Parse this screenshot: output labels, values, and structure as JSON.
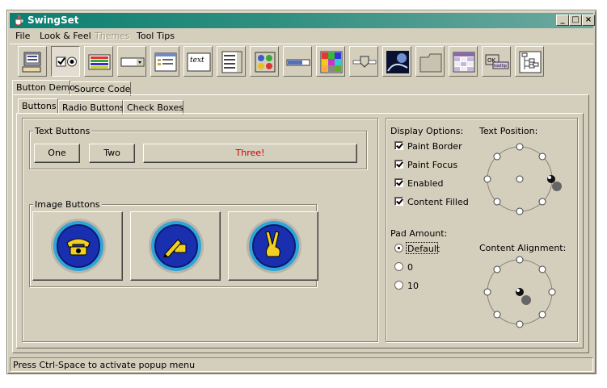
{
  "window": {
    "title": "SwingSet"
  },
  "menu": [
    "File",
    "Look & Feel",
    "Themes",
    "Tool Tips"
  ],
  "menu_disabled": [
    false,
    false,
    true,
    false
  ],
  "toolbar_icons": [
    "computer-icon",
    "radio-check-icon",
    "colored-list-icon",
    "combo-box-icon",
    "file-chooser-icon",
    "editor-text-icon",
    "list-icon",
    "option-pane-icon",
    "progress-bar-icon",
    "color-grid-icon",
    "slider-icon",
    "space-image-icon",
    "split-pane-icon",
    "table-icon",
    "tooltip-icon",
    "tree-icon"
  ],
  "outer_tabs": [
    "Button Demo",
    "Source Code"
  ],
  "inner_tabs": [
    "Buttons",
    "Radio Buttons",
    "Check Boxes"
  ],
  "text_buttons": {
    "label": "Text Buttons",
    "one": "One",
    "two": "Two",
    "three": "Three!",
    "three_color": "#cc0000"
  },
  "image_buttons": {
    "label": "Image Buttons",
    "icons": [
      "phone-icon",
      "pen-writing-icon",
      "peace-hand-icon"
    ]
  },
  "display_options": {
    "label": "Display Options:",
    "items": [
      "Paint Border",
      "Paint Focus",
      "Enabled",
      "Content Filled"
    ],
    "checked": [
      true,
      true,
      true,
      true
    ]
  },
  "pad_amount": {
    "label": "Pad Amount:",
    "options": [
      "Default",
      "0",
      "10"
    ],
    "selected": "Default"
  },
  "text_position": {
    "label": "Text Position:",
    "selected": "right"
  },
  "content_alignment": {
    "label": "Content Alignment:",
    "selected": "center"
  },
  "status": "Press Ctrl-Space to activate popup menu",
  "colors": {
    "titlebar": "#0c7f72",
    "panel": "#d4cebd",
    "button_blue": "#1a2fb0"
  }
}
